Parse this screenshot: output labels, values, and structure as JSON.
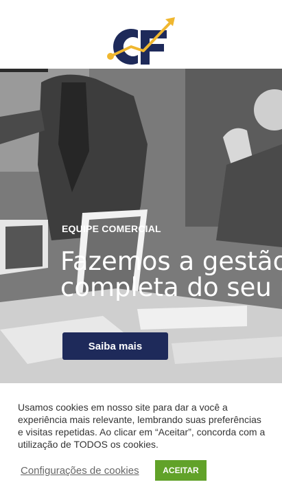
{
  "header": {
    "logo_icon": "cf-growth-arrow-logo",
    "brand_navy": "#1e2a5a",
    "brand_gold": "#f0b72f"
  },
  "hero": {
    "eyebrow": "EQUIPE COMERCIAL",
    "headline_line1": "Fazemos a gestão",
    "headline_line2": "completa do seu n",
    "cta_label": "Saiba mais"
  },
  "cookie_banner": {
    "text": "Usamos cookies em nosso site para dar a você a experiência mais relevante, lembrando suas preferências e visitas repetidas. Ao clicar em “Aceitar”, concorda com a utilização de TODOS os cookies.",
    "settings_label": "Configurações de cookies",
    "accept_label": "ACEITAR",
    "accept_color": "#61a229"
  }
}
